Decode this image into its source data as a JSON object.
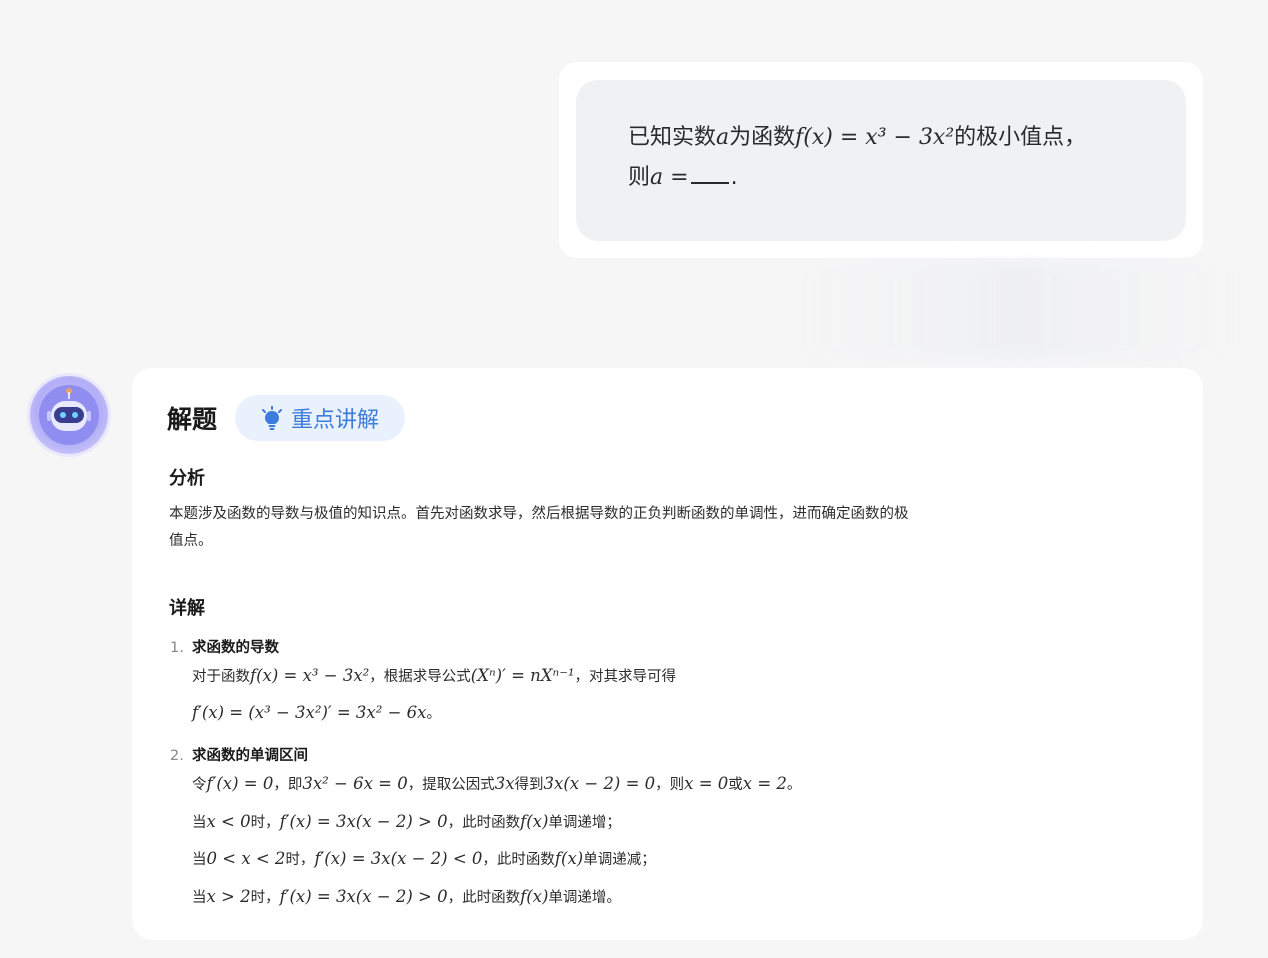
{
  "question": {
    "text_part1": "已知实数",
    "var_a": "a",
    "text_part2": "为函数",
    "func": "f(x) = x³ − 3x²",
    "text_part3": "的极小值点，",
    "text_part4": "则",
    "answer_prefix": "a =",
    "text_part5": "."
  },
  "answer": {
    "title": "解题",
    "key_button_label": "重点讲解",
    "analysis_heading": "分析",
    "analysis_text": "本题涉及函数的导数与极值的知识点。首先对函数求导，然后根据导数的正负判断函数的单调性，进而确定函数的极值点。",
    "detail_heading": "详解",
    "steps": [
      {
        "num": "1.",
        "title": "求函数的导数",
        "lines": [
          {
            "t1": "对于函数",
            "m1": "f(x) = x³ − 3x²",
            "t2": "，根据求导公式",
            "m2": "(Xⁿ)′ = nXⁿ⁻¹",
            "t3": "，对其求导可得"
          },
          {
            "m1": "f′(x) = (x³ − 3x²)′ = 3x² − 6x",
            "t1": "。"
          }
        ]
      },
      {
        "num": "2.",
        "title": "求函数的单调区间",
        "lines": [
          {
            "t1": "令",
            "m1": "f′(x) = 0",
            "t2": "，即",
            "m2": "3x² − 6x = 0",
            "t3": "，提取公因式",
            "m3": "3x",
            "t4": "得到",
            "m4": "3x(x − 2) = 0",
            "t5": "，则",
            "m5": "x = 0",
            "t6": "或",
            "m6": "x = 2",
            "t7": "。"
          },
          {
            "t1": "当",
            "m1": "x < 0",
            "t2": "时，",
            "m2": "f′(x) = 3x(x − 2) > 0",
            "t3": "，此时函数",
            "m3": "f(x)",
            "t4": "单调递增；"
          },
          {
            "t1": "当",
            "m1": "0 < x < 2",
            "t2": "时，",
            "m2": "f′(x) = 3x(x − 2) < 0",
            "t3": "，此时函数",
            "m3": "f(x)",
            "t4": "单调递减；"
          },
          {
            "t1": "当",
            "m1": "x > 2",
            "t2": "时，",
            "m2": "f′(x) = 3x(x − 2) > 0",
            "t3": "，此时函数",
            "m3": "f(x)",
            "t4": "单调递增。"
          }
        ]
      }
    ]
  },
  "colors": {
    "accent": "#3d7bdc",
    "accent_bg": "#e9f1fd",
    "avatar": "#8f8df0"
  }
}
